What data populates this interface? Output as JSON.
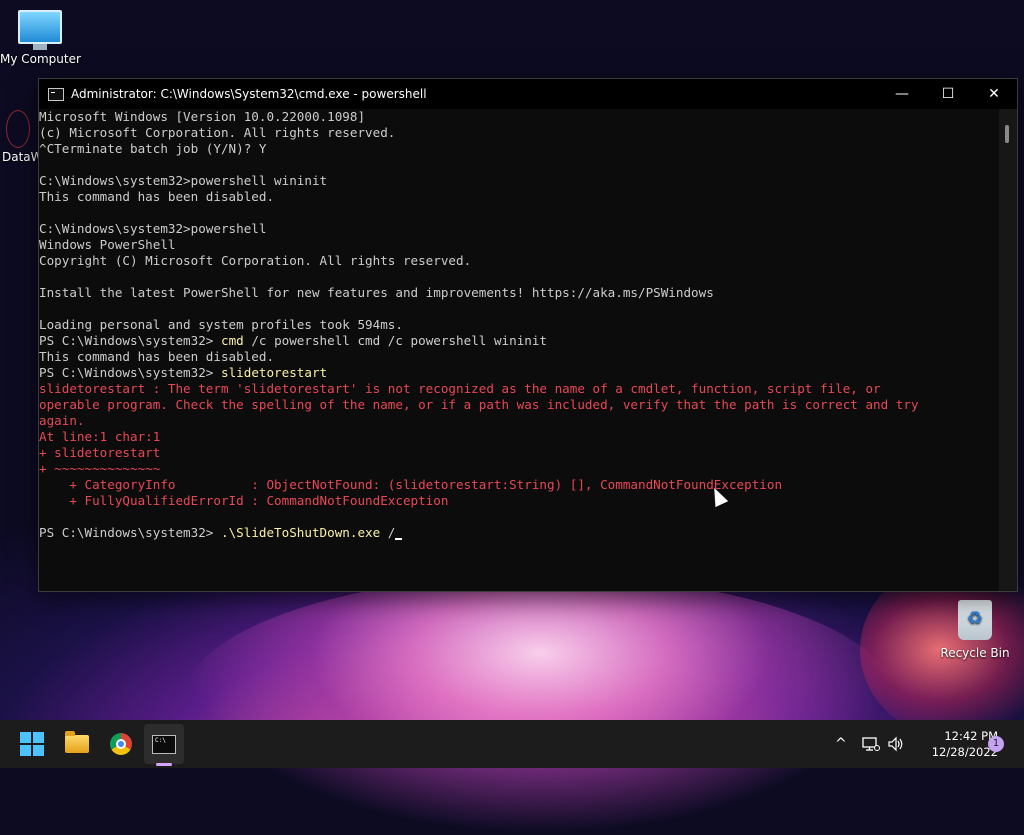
{
  "desktop": {
    "icons": [
      {
        "label": "My Computer"
      },
      {
        "label": "DataW"
      },
      {
        "label": "Recycle Bin"
      }
    ]
  },
  "window": {
    "title": "Administrator: C:\\Windows\\System32\\cmd.exe - powershell",
    "controls": {
      "minimize": "—",
      "maximize": "☐",
      "close": "✕"
    }
  },
  "console": {
    "lines": [
      {
        "t": "Microsoft Windows [Version 10.0.22000.1098]"
      },
      {
        "t": "(c) Microsoft Corporation. All rights reserved."
      },
      {
        "t": "^CTerminate batch job (Y/N)? Y"
      },
      {
        "t": ""
      },
      {
        "t": "C:\\Windows\\system32>powershell wininit"
      },
      {
        "t": "This command has been disabled."
      },
      {
        "t": ""
      },
      {
        "t": "C:\\Windows\\system32>powershell"
      },
      {
        "t": "Windows PowerShell"
      },
      {
        "t": "Copyright (C) Microsoft Corporation. All rights reserved."
      },
      {
        "t": ""
      },
      {
        "t": "Install the latest PowerShell for new features and improvements! https://aka.ms/PSWindows"
      },
      {
        "t": ""
      },
      {
        "t": "Loading personal and system profiles took 594ms."
      },
      {
        "p": "PS C:\\Windows\\system32> ",
        "c": "cmd",
        "r": " /c powershell cmd /c powershell wininit"
      },
      {
        "t": "This command has been disabled."
      },
      {
        "p": "PS C:\\Windows\\system32> ",
        "c": "slidetorestart",
        "r": ""
      },
      {
        "e": "slidetorestart : The term 'slidetorestart' is not recognized as the name of a cmdlet, function, script file, or"
      },
      {
        "e": "operable program. Check the spelling of the name, or if a path was included, verify that the path is correct and try"
      },
      {
        "e": "again."
      },
      {
        "e": "At line:1 char:1"
      },
      {
        "e": "+ slidetorestart"
      },
      {
        "e": "+ ~~~~~~~~~~~~~~"
      },
      {
        "e": "    + CategoryInfo          : ObjectNotFound: (slidetorestart:String) [], CommandNotFoundException"
      },
      {
        "e": "    + FullyQualifiedErrorId : CommandNotFoundException"
      },
      {
        "t": ""
      },
      {
        "p": "PS C:\\Windows\\system32> ",
        "c": ".\\SlideToShutDown.exe",
        "r": " /"
      }
    ]
  },
  "taskbar": {
    "apps": [
      {
        "icon": "start-icon"
      },
      {
        "icon": "file-explorer-icon"
      },
      {
        "icon": "chrome-icon"
      },
      {
        "icon": "terminal-icon",
        "active": true
      }
    ],
    "tray": {
      "chevron": "^",
      "time": "12:42 PM",
      "date": "12/28/2022",
      "notifications": "1"
    }
  }
}
